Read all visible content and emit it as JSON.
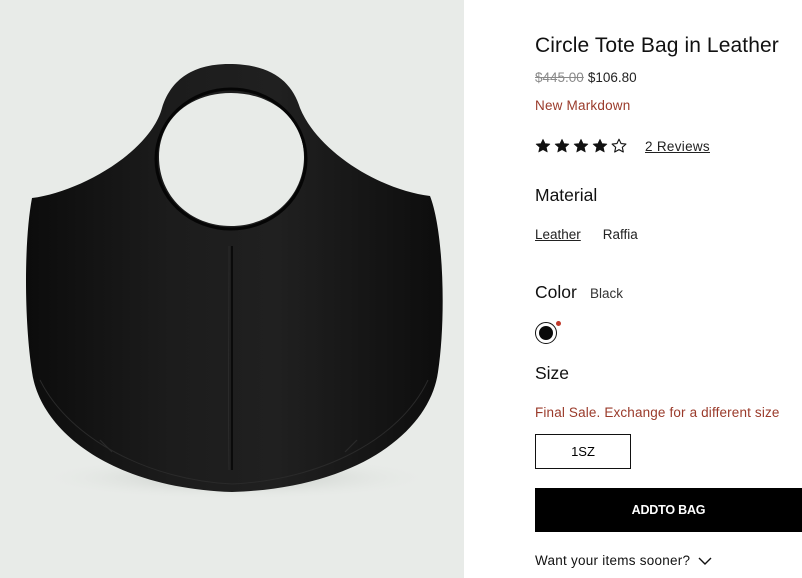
{
  "product": {
    "title": "Circle Tote Bag in Leather",
    "original_price": "$445.00",
    "sale_price": "$106.80",
    "markdown_label": "New Markdown",
    "rating": 4,
    "rating_max": 5,
    "reviews_text": "2 Reviews"
  },
  "material": {
    "label": "Material",
    "options": [
      "Leather",
      "Raffia"
    ],
    "selected": "Leather"
  },
  "color": {
    "label": "Color",
    "value": "Black",
    "swatch_color": "#0a0a0a",
    "indicator_color": "#c0392b"
  },
  "size": {
    "label": "Size",
    "notice": "Final Sale. Exchange for a different size",
    "notice_color": "#9a3a2a",
    "option": "1SZ"
  },
  "actions": {
    "add_to_bag": "ADDTO BAG",
    "sooner": "Want your items sooner?"
  },
  "icons": {
    "star_filled": "star-filled-icon",
    "star_empty": "star-outline-icon",
    "chevron": "chevron-down-icon"
  }
}
